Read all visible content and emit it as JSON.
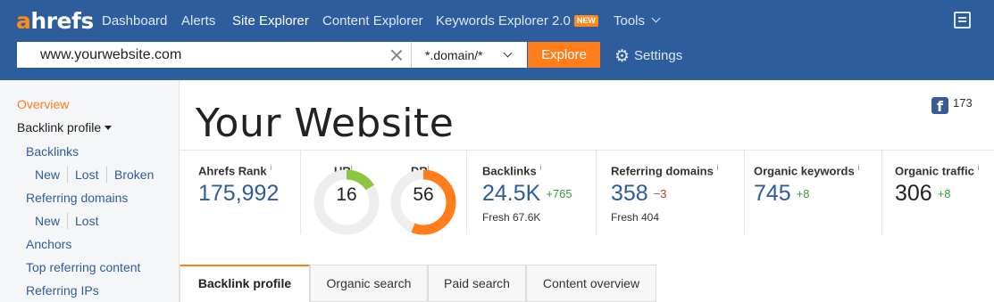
{
  "header": {
    "logo": {
      "accent": "a",
      "rest": "hrefs"
    },
    "nav": [
      {
        "label": "Dashboard"
      },
      {
        "label": "Alerts"
      },
      {
        "label": "Site Explorer"
      },
      {
        "label": "Content Explorer"
      },
      {
        "label": "Keywords Explorer 2.0",
        "badge": "NEW"
      },
      {
        "label": "Tools"
      }
    ],
    "active_nav": "Site Explorer"
  },
  "search": {
    "value": "www.yourwebsite.com",
    "mode": "*.domain/*",
    "explore_label": "Explore",
    "settings_label": "Settings"
  },
  "sidebar": {
    "overview": "Overview",
    "backlink_profile": "Backlink profile",
    "backlinks": "Backlinks",
    "backlinks_sub": [
      "New",
      "Lost",
      "Broken"
    ],
    "referring_domains": "Referring domains",
    "referring_domains_sub": [
      "New",
      "Lost"
    ],
    "anchors": "Anchors",
    "top_referring_content": "Top referring content",
    "referring_ips": "Referring IPs"
  },
  "site": {
    "title": "Your Website",
    "fb_count": "173"
  },
  "metrics": {
    "ahrefs_rank": {
      "label": "Ahrefs Rank",
      "value": "175,992"
    },
    "ur": {
      "label": "UR",
      "value": "16",
      "fraction": 0.16
    },
    "dr": {
      "label": "DR",
      "value": "56",
      "fraction": 0.56
    },
    "backlinks": {
      "label": "Backlinks",
      "value": "24.5K",
      "delta": "+765",
      "fresh": "Fresh 67.6K"
    },
    "referring_domains": {
      "label": "Referring domains",
      "value": "358",
      "delta": "−3",
      "fresh": "Fresh 404"
    },
    "organic_keywords": {
      "label": "Organic keywords",
      "value": "745",
      "delta": "+8"
    },
    "organic_traffic": {
      "label": "Organic traffic",
      "value": "306",
      "delta": "+8"
    }
  },
  "tabs": [
    {
      "label": "Backlink profile"
    },
    {
      "label": "Organic search"
    },
    {
      "label": "Paid search"
    },
    {
      "label": "Content overview"
    }
  ],
  "colors": {
    "header_bg": "#2e5d9e",
    "accent_orange": "#ff7d1a",
    "ur_green": "#8cc63f",
    "dr_orange": "#ff7d1a",
    "link_blue": "#2e5d9e"
  }
}
